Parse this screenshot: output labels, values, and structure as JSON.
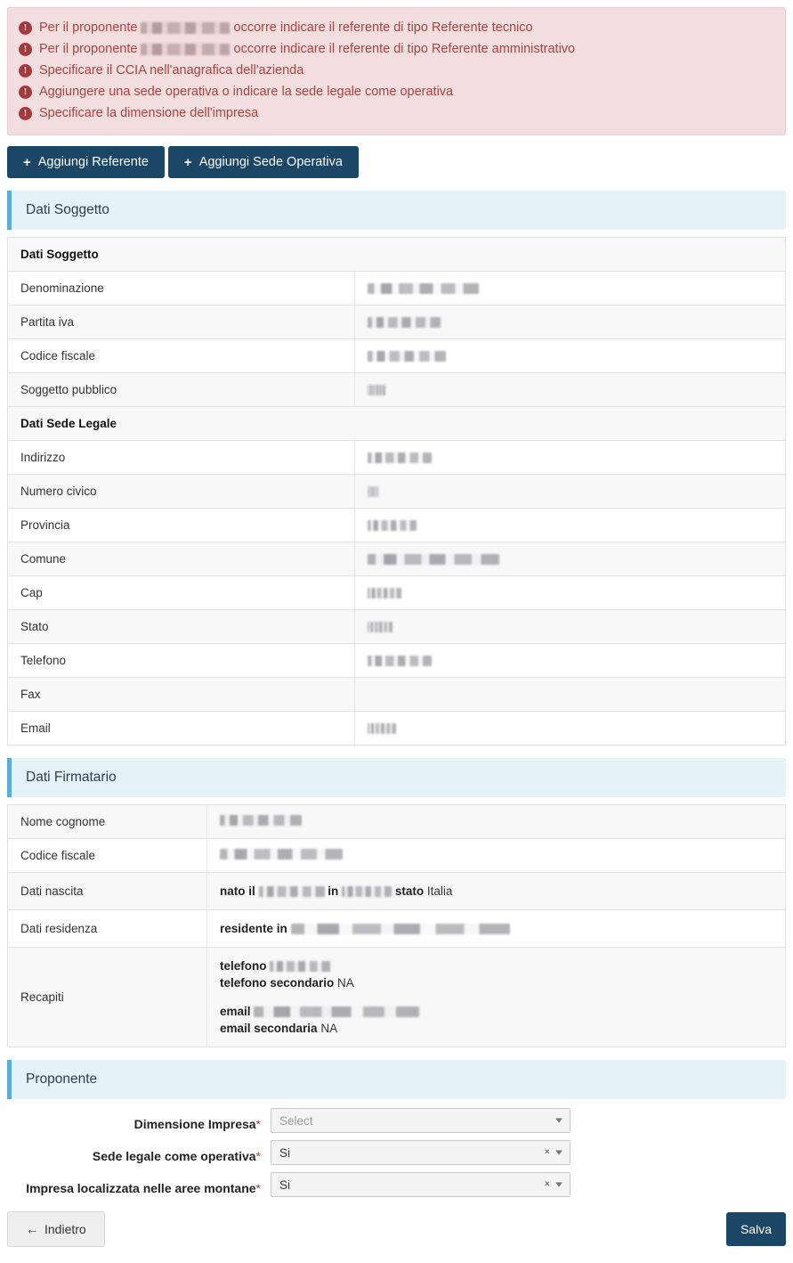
{
  "colors": {
    "alert_bg": "#f2dede",
    "alert_border": "#ebccd1",
    "alert_text": "#a94442",
    "section_bg": "#e4f2f9",
    "section_accent": "#5bacd6",
    "button_dark": "#1b4665",
    "required_star": "#c0392b"
  },
  "alerts": {
    "items": [
      {
        "icon": "exclamation-circle-icon",
        "before": "Per il proponente",
        "redacted": true,
        "after": "occorre indicare il referente di tipo Referente tecnico"
      },
      {
        "icon": "exclamation-circle-icon",
        "before": "Per il proponente",
        "redacted": true,
        "after": "occorre indicare il referente di tipo Referente amministrativo"
      },
      {
        "icon": "exclamation-circle-icon",
        "before": "Specificare il CCIA nell'anagrafica dell'azienda",
        "redacted": false,
        "after": ""
      },
      {
        "icon": "exclamation-circle-icon",
        "before": "Aggiungere una sede operativa o indicare la sede legale come operativa",
        "redacted": false,
        "after": ""
      },
      {
        "icon": "exclamation-circle-icon",
        "before": "Specificare la dimensione dell'impresa",
        "redacted": false,
        "after": ""
      }
    ]
  },
  "toolbar": {
    "plus_glyph": "+",
    "add_referente_label": "Aggiungi Referente",
    "add_sede_operativa_label": "Aggiungi Sede Operativa"
  },
  "sections": {
    "dati_soggetto": {
      "title": "Dati Soggetto"
    },
    "dati_firmatario": {
      "title": "Dati Firmatario"
    },
    "proponente": {
      "title": "Proponente"
    }
  },
  "soggetto_table": {
    "groups": [
      {
        "heading": "Dati Soggetto",
        "rows": [
          {
            "label": "Denominazione",
            "value": "",
            "redacted": true,
            "redact_width": 125
          },
          {
            "label": "Partita iva",
            "value": "",
            "redacted": true,
            "redact_width": 82
          },
          {
            "label": "Codice fiscale",
            "value": "",
            "redacted": true,
            "redact_width": 88
          },
          {
            "label": "Soggetto pubblico",
            "value": "",
            "redacted": true,
            "redact_width": 20
          }
        ]
      },
      {
        "heading": "Dati Sede Legale",
        "rows": [
          {
            "label": "Indirizzo",
            "value": "",
            "redacted": true,
            "redact_width": 72
          },
          {
            "label": "Numero civico",
            "value": "",
            "redacted": true,
            "redact_width": 12
          },
          {
            "label": "Provincia",
            "value": "",
            "redacted": true,
            "redact_width": 55
          },
          {
            "label": "Comune",
            "value": "",
            "redacted": true,
            "redact_width": 148
          },
          {
            "label": "Cap",
            "value": "",
            "redacted": true,
            "redact_width": 38
          },
          {
            "label": "Stato",
            "value": "",
            "redacted": true,
            "redact_width": 28
          },
          {
            "label": "Telefono",
            "value": "",
            "redacted": true,
            "redact_width": 72
          },
          {
            "label": "Fax",
            "value": "",
            "redacted": false,
            "redact_width": 0
          },
          {
            "label": "Email",
            "value": "",
            "redacted": true,
            "redact_width": 32
          }
        ]
      }
    ]
  },
  "firmatario_table": {
    "rows": [
      {
        "label": "Nome cognome",
        "kind": "redacted",
        "redact_width": 92
      },
      {
        "label": "Codice fiscale",
        "kind": "redacted",
        "redact_width": 138
      },
      {
        "label": "Dati nascita",
        "kind": "kv-inline",
        "parts": [
          {
            "bold": "nato il",
            "redact_width": 74
          },
          {
            "bold": "in",
            "redact_width": 56
          },
          {
            "bold": "stato",
            "text": "Italia"
          }
        ]
      },
      {
        "label": "Dati residenza",
        "kind": "kv-inline",
        "parts": [
          {
            "bold": "residente in",
            "redact_width": 246
          }
        ]
      },
      {
        "label": "Recapiti",
        "kind": "recapiti",
        "lines": [
          {
            "bold": "telefono",
            "redact_width": 68
          },
          {
            "bold": "telefono secondario",
            "text": "NA"
          },
          {
            "spacer": true
          },
          {
            "bold": "email",
            "redact_width": 186
          },
          {
            "bold": "email secondaria",
            "text": "NA"
          }
        ]
      }
    ]
  },
  "proponente_form": {
    "fields": [
      {
        "label": "Dimensione Impresa",
        "required": true,
        "value": "",
        "placeholder": "Select",
        "clearable": false
      },
      {
        "label": "Sede legale come operativa",
        "required": true,
        "value": "Si",
        "placeholder": "Select",
        "clearable": true
      },
      {
        "label": "Impresa localizzata nelle aree montane",
        "required": true,
        "value": "Si",
        "placeholder": "Select",
        "clearable": true
      }
    ],
    "clear_glyph": "×",
    "required_glyph": "*"
  },
  "footer": {
    "back_label": "Indietro",
    "back_arrow": "←",
    "save_label": "Salva"
  }
}
